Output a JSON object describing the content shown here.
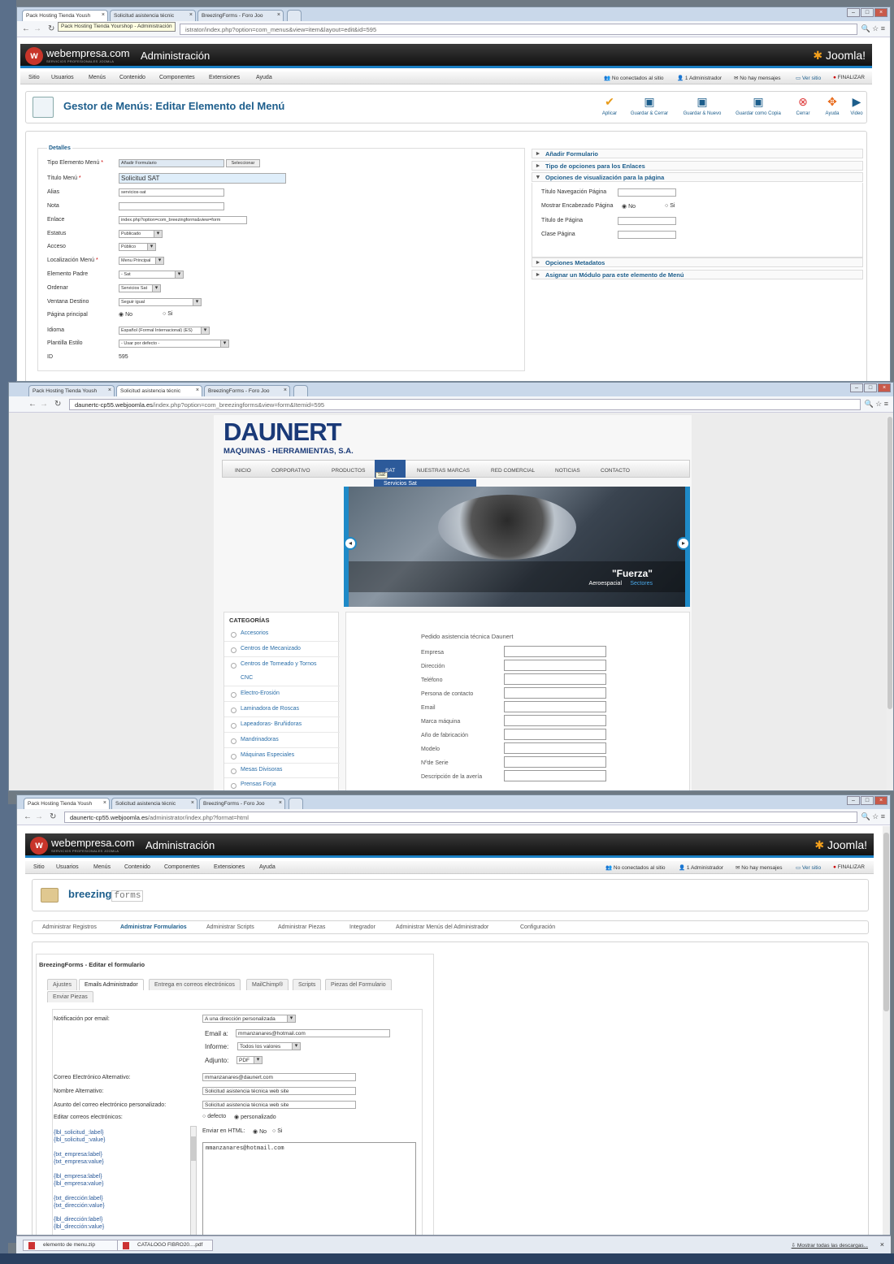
{
  "tabs": {
    "pack_hosting": "Pack Hosting Tienda Yoush",
    "solicitud": "Solicitud asistencia técnic",
    "breezing": "BreezingForms - Foro Joo"
  },
  "window1": {
    "tooltip": "Pack Hosting Tienda Yourshop - Administración",
    "url_rest": "istrator/index.php?option=com_menus&view=item&layout=edit&id=595"
  },
  "joomla_header": {
    "logo_text": "webempresa.com",
    "logo_sub": "SERVICIOS PROFESIONALES JOOMLA",
    "admin_title": "Administración",
    "brand": "Joomla!"
  },
  "top_menu": [
    "Sitio",
    "Usuarios",
    "Menús",
    "Contenido",
    "Componentes",
    "Extensiones",
    "Ayuda"
  ],
  "status": {
    "not_connected": "No conectados al sitio",
    "admins": "1 Administrador",
    "messages": "No hay mensajes",
    "view_site": "Ver sitio",
    "logout": "FINALIZAR"
  },
  "menu_editor": {
    "title": "Gestor de Menús: Editar Elemento del Menú",
    "toolbar": [
      "Aplicar",
      "Guardar & Cerrar",
      "Guardar & Nuevo",
      "Guardar como Copia",
      "Cerrar",
      "Ayuda",
      "Video"
    ],
    "details_legend": "Detalles",
    "fields": {
      "type_label": "Tipo Elemento Menú",
      "type_value": "Añadir Formulario",
      "select_btn": "Seleccionar",
      "title_label": "Título Menú",
      "title_value": "Solicitud SAT",
      "alias_label": "Alias",
      "alias_value": "servicios-sat",
      "note_label": "Nota",
      "link_label": "Enlace",
      "link_value": "index.php?option=com_breezingforms&view=form",
      "status_label": "Estatus",
      "status_value": "Publicado",
      "access_label": "Acceso",
      "access_value": "Público",
      "location_label": "Localización Menú",
      "location_value": "Menu Principal",
      "parent_label": "Elemento Padre",
      "parent_value": "- Sat",
      "order_label": "Ordenar",
      "order_value": "Servicios Sat",
      "target_label": "Ventana Destino",
      "target_value": "Seguir igual",
      "home_label": "Página principal",
      "no": "No",
      "si": "Si",
      "lang_label": "Idioma",
      "lang_value": "Español (Formal Internacional) (ES)",
      "style_label": "Plantilla Estilo",
      "style_value": "- Usar por defecto -",
      "id_label": "ID",
      "id_value": "595"
    },
    "accordion": {
      "add_form": "Añadir Formulario",
      "link_type": "Tipo de opciones para los Enlaces",
      "page_display": "Opciones de visualización para la página",
      "nav_title": "Título Navegación Página",
      "show_heading": "Mostrar Encabezado Página",
      "page_title": "Título de Página",
      "page_class": "Clase Página",
      "metadata": "Opciones Metadatos",
      "module": "Asignar un Módulo para este elemento de Menú"
    }
  },
  "window2": {
    "url_host": "daunertc-cp55.webjoomla.es",
    "url_rest": "/index.php?option=com_breezingforms&view=form&Itemid=595"
  },
  "daunert": {
    "logo_top": "DAUNERT",
    "logo_bottom": "MAQUINAS - HERRAMIENTAS, S.A.",
    "nav": [
      "INICIO",
      "CORPORATIVO",
      "PRODUCTOS",
      "SAT",
      "NUESTRAS MARCAS",
      "RED COMERCIAL",
      "NOTICIAS",
      "CONTACTO"
    ],
    "sat_tooltip": "Sat",
    "submenu": "Servicios Sat",
    "slide_title": "\"Fuerza\"",
    "slide_cat": "Aeroespacial",
    "slide_sectors": "Sectores",
    "categories_title": "CATEGORÍAS",
    "categories": [
      "Accesorios",
      "Centros de Mecanizado",
      "Centros de Torneado y Tornos",
      "CNC",
      "Electro-Erosión",
      "Laminadora de Roscas",
      "Lapeadoras- Bruñidoras",
      "Mandrinadoras",
      "Máquinas Especiales",
      "Mesas Divisoras",
      "Prensas Forja"
    ],
    "form_title": "Pedido asistencia técnica Daunert",
    "form_fields": [
      "Empresa",
      "Dirección",
      "Teléfono",
      "Persona de contacto",
      "Email",
      "Marca máquina",
      "Año de fabricación",
      "Modelo",
      "Nºde Serie",
      "Descripción de la avería"
    ]
  },
  "window3": {
    "url_host": "daunertc-cp55.webjoomla.es",
    "url_rest": "/administrator/index.php?format=html"
  },
  "breezing": {
    "logo_a": "breezing",
    "logo_b": "forms",
    "tabs": [
      "Administrar Registros",
      "Administrar Formularios",
      "Administrar Scripts",
      "Administrar Piezas",
      "Integrador",
      "Administrar Menús del Administrador",
      "Configuración"
    ],
    "form_title": "BreezingForms - Editar el formulario",
    "subtabs": [
      "Ajustes",
      "Emails Administrador",
      "Entrega en correos electrónicos",
      "MailChimp®",
      "Scripts",
      "Piezas del Formulario",
      "Enviar Piezas"
    ],
    "notif_label": "Notificación por email:",
    "notif_value": "A una dirección personalizada",
    "email_label": "Email a:",
    "email_value": "mmanzanares@hotmail.com",
    "report_label": "Informe:",
    "report_value": "Todos los valores",
    "attach_label": "Adjunto:",
    "attach_value": "PDF",
    "alt_email_label": "Correo Electrónico Alternativo:",
    "alt_email_value": "mmanzanares@daunert.com",
    "alt_name_label": "Nombre Alternativo:",
    "alt_name_value": "Solicitud asistencia técnica web site",
    "subject_label": "Asunto del correo electrónico personalizado:",
    "subject_value": "Solicitud asistencia técnica web site",
    "edit_label": "Editar correos electrónicos:",
    "default_opt": "defecto",
    "custom_opt": "personalizado",
    "html_label": "Enviar en HTML:",
    "no": "No",
    "si": "Si",
    "tokens": [
      "{lbl_solicitud_:label}\n{lbl_solicitud_:value}",
      "{txt_empresa:label}\n{txt_empresa:value}",
      "{lbl_empresa:label}\n{lbl_empresa:value}",
      "{txt_dirección:label}\n{txt_dirección:value}",
      "{lbl_dirección:label}\n{lbl_dirección:value}"
    ],
    "body_value": "mmanzanares@hotmail.com"
  },
  "downloads": {
    "item1": "elemento de menu.zip",
    "item2": "CATALOGO FIBRO20....pdf",
    "show_all": "Mostrar todas las descargas..."
  }
}
